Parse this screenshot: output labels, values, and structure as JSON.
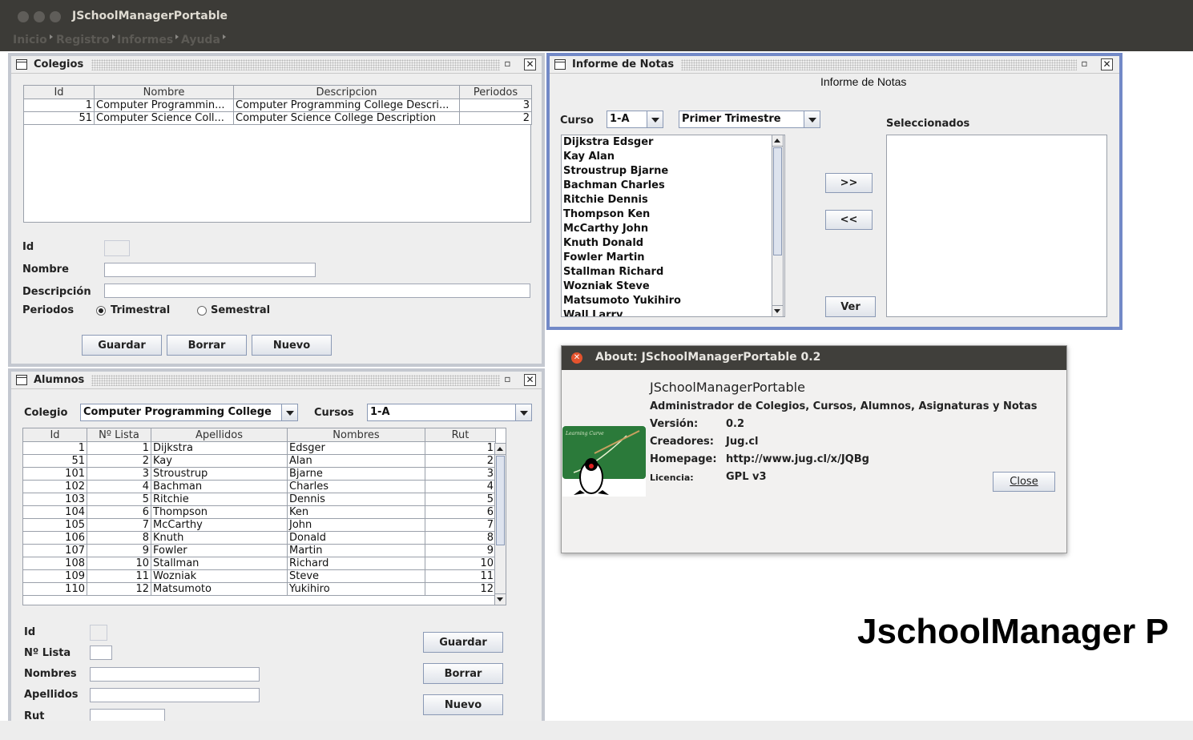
{
  "window": {
    "title": "JSchoolManagerPortable",
    "menu": [
      "Inicio",
      "Registro",
      "Informes",
      "Ayuda"
    ]
  },
  "colegios": {
    "title": "Colegios",
    "columns": [
      "Id",
      "Nombre",
      "Descripcion",
      "Periodos"
    ],
    "rows": [
      [
        "1",
        "Computer Programmin...",
        "Computer Programming College Descri...",
        "3"
      ],
      [
        "51",
        "Computer Science Coll...",
        "Computer Science College Description",
        "2"
      ]
    ],
    "labels": {
      "id": "Id",
      "nombre": "Nombre",
      "descripcion": "Descripción",
      "periodos": "Periodos"
    },
    "radio_trimestral": "Trimestral",
    "radio_semestral": "Semestral",
    "buttons": {
      "guardar": "Guardar",
      "borrar": "Borrar",
      "nuevo": "Nuevo"
    }
  },
  "alumnos": {
    "title": "Alumnos",
    "colegio_label": "Colegio",
    "colegio_value": "Computer Programming College",
    "cursos_label": "Cursos",
    "cursos_value": "1-A",
    "columns": [
      "Id",
      "Nº Lista",
      "Apellidos",
      "Nombres",
      "Rut"
    ],
    "rows": [
      [
        "1",
        "1",
        "Dijkstra",
        "Edsger",
        "1"
      ],
      [
        "51",
        "2",
        "Kay",
        "Alan",
        "2"
      ],
      [
        "101",
        "3",
        "Stroustrup",
        "Bjarne",
        "3"
      ],
      [
        "102",
        "4",
        "Bachman",
        "Charles",
        "4"
      ],
      [
        "103",
        "5",
        "Ritchie",
        "Dennis",
        "5"
      ],
      [
        "104",
        "6",
        "Thompson",
        "Ken",
        "6"
      ],
      [
        "105",
        "7",
        "McCarthy",
        "John",
        "7"
      ],
      [
        "106",
        "8",
        "Knuth",
        "Donald",
        "8"
      ],
      [
        "107",
        "9",
        "Fowler",
        "Martin",
        "9"
      ],
      [
        "108",
        "10",
        "Stallman",
        "Richard",
        "10"
      ],
      [
        "109",
        "11",
        "Wozniak",
        "Steve",
        "11"
      ],
      [
        "110",
        "12",
        "Matsumoto",
        "Yukihiro",
        "12"
      ]
    ],
    "labels": {
      "id": "Id",
      "nlista": "Nº Lista",
      "nombres": "Nombres",
      "apellidos": "Apellidos",
      "rut": "Rut"
    },
    "buttons": {
      "guardar": "Guardar",
      "borrar": "Borrar",
      "nuevo": "Nuevo"
    }
  },
  "notas": {
    "title": "Informe de Notas",
    "heading": "Informe de Notas",
    "curso_label": "Curso",
    "curso_value": "1-A",
    "periodo_value": "Primer Trimestre",
    "seleccionados_label": "Seleccionados",
    "students": [
      "Dijkstra Edsger",
      "Kay Alan",
      "Stroustrup Bjarne",
      "Bachman Charles",
      "Ritchie Dennis",
      "Thompson Ken",
      "McCarthy John",
      "Knuth Donald",
      "Fowler Martin",
      "Stallman Richard",
      "Wozniak Steve",
      "Matsumoto Yukihiro",
      "Wall Larry"
    ],
    "add_button": ">>",
    "remove_button": "<<",
    "ver_button": "Ver"
  },
  "about": {
    "title": "About: JSchoolManagerPortable 0.2",
    "app_name": "JSchoolManagerPortable",
    "description": "Administrador de Colegios, Cursos, Alumnos, Asignaturas y Notas",
    "version_label": "Versión:",
    "version_value": "0.2",
    "creators_label": "Creadores:",
    "creators_value": "Jug.cl",
    "homepage_label": "Homepage:",
    "homepage_value": "http://www.jug.cl/x/JQBg",
    "license_label": "Licencia:",
    "license_value": "GPL v3",
    "logo_caption": "Learning Curve",
    "close_button": "Close"
  },
  "banner": "JschoolManager P"
}
